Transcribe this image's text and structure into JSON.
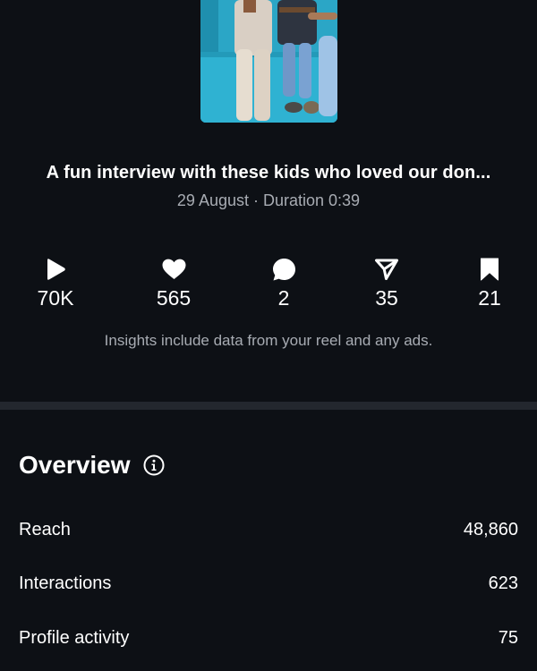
{
  "reel": {
    "title": "A fun interview with these kids who loved our don...",
    "meta": "29 August · Duration 0:39"
  },
  "stats": [
    {
      "icon": "play-icon",
      "value": "70K"
    },
    {
      "icon": "heart-icon",
      "value": "565"
    },
    {
      "icon": "comment-icon",
      "value": "2"
    },
    {
      "icon": "share-icon",
      "value": "35"
    },
    {
      "icon": "bookmark-icon",
      "value": "21"
    }
  ],
  "note": "Insights include data from your reel and any ads.",
  "overview": {
    "title": "Overview",
    "metrics": [
      {
        "label": "Reach",
        "value": "48,860"
      },
      {
        "label": "Interactions",
        "value": "623"
      },
      {
        "label": "Profile activity",
        "value": "75"
      }
    ]
  },
  "colors": {
    "background": "#0d1015",
    "secondary_text": "#a8acb3",
    "divider": "#23272e"
  }
}
